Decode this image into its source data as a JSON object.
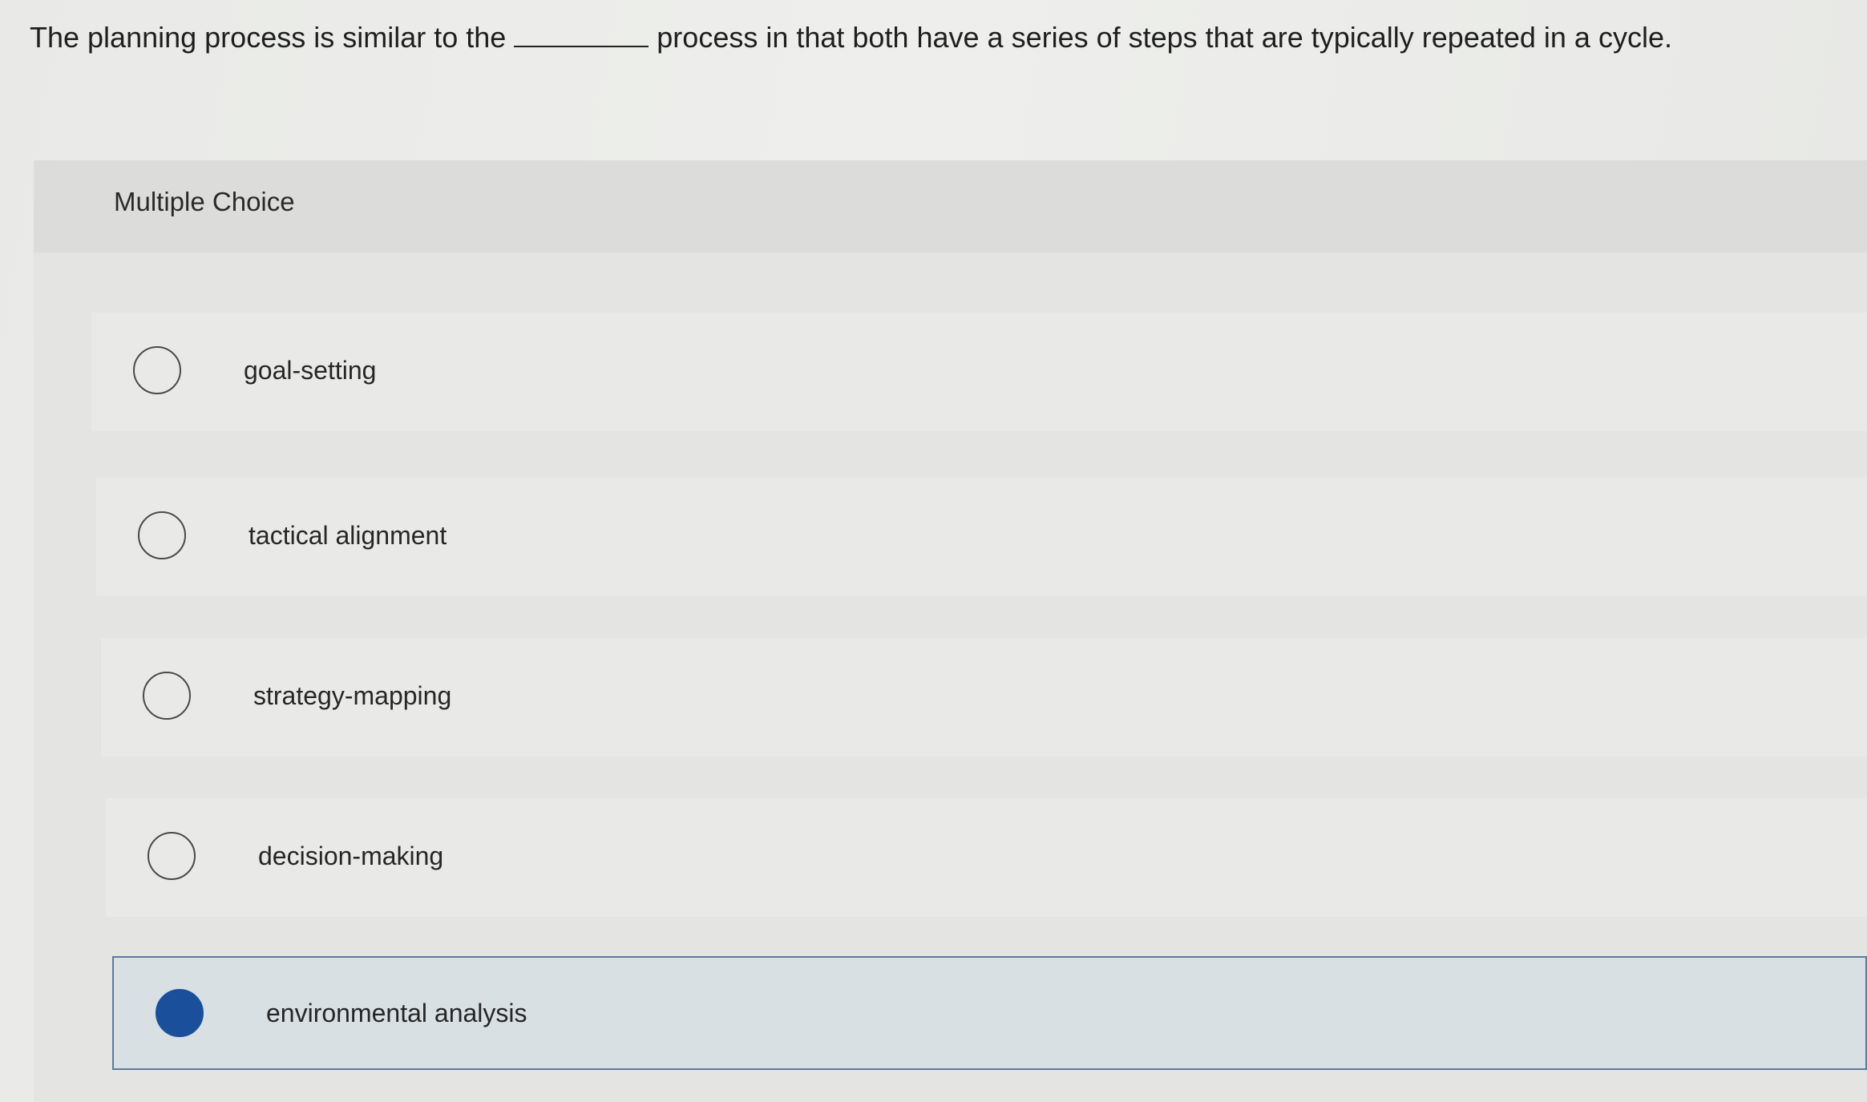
{
  "question": {
    "before_blank": "The planning process is similar to the",
    "after_blank": "process in that both have a series of steps that are typically repeated in a cycle."
  },
  "panel": {
    "label": "Multiple Choice"
  },
  "options": [
    {
      "label": "goal-setting",
      "selected": false
    },
    {
      "label": "tactical alignment",
      "selected": false
    },
    {
      "label": "strategy-mapping",
      "selected": false
    },
    {
      "label": "decision-making",
      "selected": false
    },
    {
      "label": "environmental analysis",
      "selected": true
    }
  ],
  "colors": {
    "selected_radio": "#1a4f9c",
    "selected_border": "#5d7a99",
    "selected_background": "#d9e0e3"
  }
}
